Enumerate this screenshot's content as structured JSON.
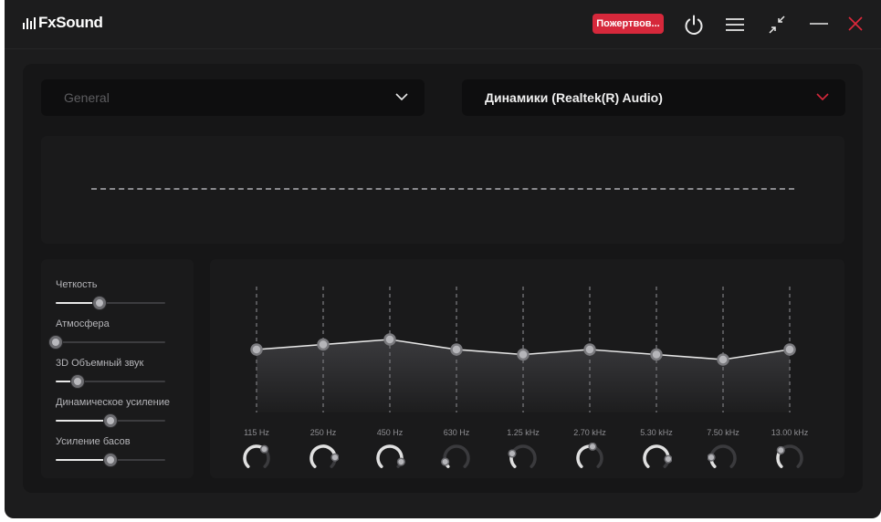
{
  "app": {
    "name": "FxSound"
  },
  "titlebar": {
    "donate_label": "Пожертвов...",
    "icons": [
      "power-icon",
      "menu-icon",
      "minimize-view-icon",
      "minimize-icon",
      "close-icon"
    ],
    "close_color": "#e0283c"
  },
  "preset": {
    "selected": "General"
  },
  "device": {
    "selected": "Динамики (Realtek(R) Audio)",
    "caret_color": "#d6283b"
  },
  "accent": "#d6283b",
  "effects": [
    {
      "label": "Четкость",
      "value": 0.4
    },
    {
      "label": "Атмосфера",
      "value": 0.0
    },
    {
      "label": "3D Объемный звук",
      "value": 0.2
    },
    {
      "label": "Динамическое усиление",
      "value": 0.5
    },
    {
      "label": "Усиление басов",
      "value": 0.5
    }
  ],
  "eq": {
    "bands": [
      {
        "label": "115 Hz",
        "gain": 0.0,
        "knob": 0.65
      },
      {
        "label": "250 Hz",
        "gain": 0.05,
        "knob": 0.82
      },
      {
        "label": "450 Hz",
        "gain": 0.1,
        "knob": 0.9
      },
      {
        "label": "630 Hz",
        "gain": 0.0,
        "knob": 0.1
      },
      {
        "label": "1.25 kHz",
        "gain": -0.05,
        "knob": 0.25
      },
      {
        "label": "2.70 kHz",
        "gain": 0.0,
        "knob": 0.55
      },
      {
        "label": "5.30 kHz",
        "gain": -0.05,
        "knob": 0.85
      },
      {
        "label": "7.50 kHz",
        "gain": -0.1,
        "knob": 0.18
      },
      {
        "label": "13.00 kHz",
        "gain": 0.0,
        "knob": 0.32
      }
    ]
  }
}
